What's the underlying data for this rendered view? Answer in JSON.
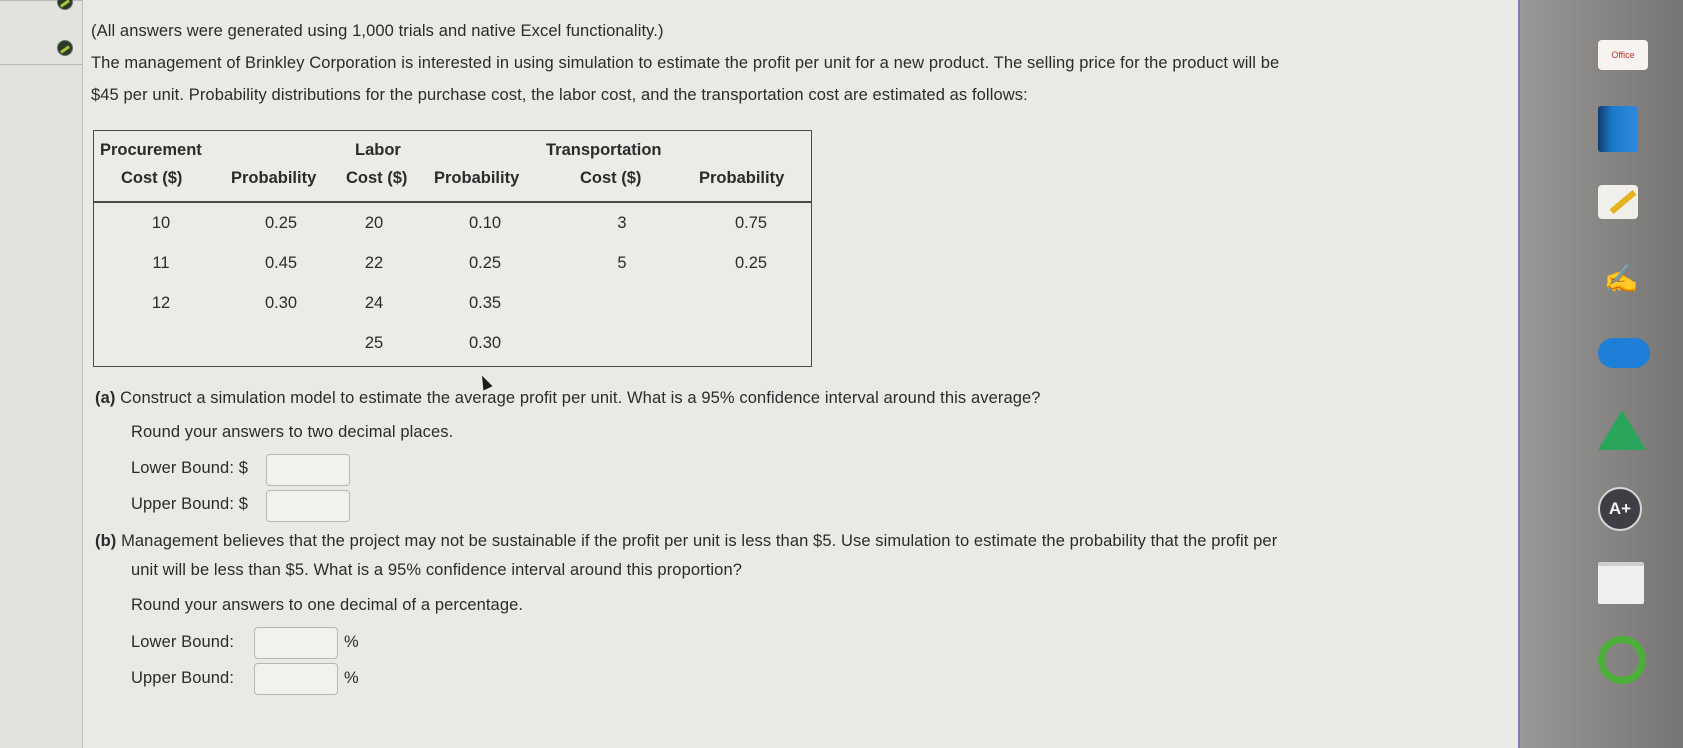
{
  "intro": "(All answers were generated using 1,000 trials and native Excel functionality.)",
  "problem": {
    "line1": "The management of Brinkley Corporation is interested in using simulation to estimate the profit per unit for a new product. The selling price for the product will be",
    "line2": "$45 per unit. Probability distributions for the purchase cost, the labor cost, and the transportation cost are estimated as follows:"
  },
  "table": {
    "headers": {
      "procurement_top": "Procurement",
      "procurement_bottom": "Cost ($)",
      "prob1": "Probability",
      "labor_top": "Labor",
      "labor_bottom": "Cost ($)",
      "prob2": "Probability",
      "transport_top": "Transportation",
      "transport_bottom": "Cost ($)",
      "prob3": "Probability"
    },
    "rows": [
      [
        "10",
        "0.25",
        "20",
        "0.10",
        "3",
        "0.75"
      ],
      [
        "11",
        "0.45",
        "22",
        "0.25",
        "5",
        "0.25"
      ],
      [
        "12",
        "0.30",
        "24",
        "0.35",
        "",
        ""
      ],
      [
        "",
        "",
        "25",
        "0.30",
        "",
        ""
      ]
    ]
  },
  "part_a": {
    "tag": "(a)",
    "question": "Construct a simulation model to estimate the average profit per unit. What is a 95% confidence interval around this average?",
    "round_note": "Round your answers to two decimal places.",
    "lower_label": "Lower Bound: $",
    "upper_label": "Upper Bound: $",
    "lower_value": "",
    "upper_value": ""
  },
  "part_b": {
    "tag": "(b)",
    "question_line1": "Management believes that the project may not be sustainable if the profit per unit is less than $5. Use simulation to estimate the probability that the profit per",
    "question_line2": "unit will be less than $5. What is a 95% confidence interval around this proportion?",
    "round_note": "Round your answers to one decimal of a percentage.",
    "lower_label": "Lower Bound:",
    "upper_label": "Upper Bound:",
    "unit": "%",
    "lower_value": "",
    "upper_value": ""
  },
  "dock": {
    "office_label": "Office",
    "icons": [
      "office-icon",
      "book-icon",
      "notes-icon",
      "scribble-icon",
      "cloud-icon",
      "drive-icon",
      "aplus-icon",
      "doc-icon",
      "ring-icon"
    ],
    "aplus_text": "A+"
  },
  "colors": {
    "page_bg": "#e9e9e6",
    "dock_bg": "#8c8a88",
    "accent_border": "#7d7fb4"
  }
}
